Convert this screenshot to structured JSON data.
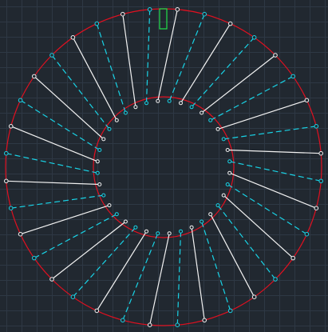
{
  "drawing": {
    "colors": {
      "background": "#212830",
      "grid": "#2e3844",
      "circles": "#e01020",
      "solid_lines": "#f2f2f2",
      "dashed_lines": "#19d3e6",
      "slot_marker": "#22e04a",
      "inner_node_white": "#f2f2f2",
      "inner_node_cyan": "#19d3e6"
    },
    "spoke_count": 36,
    "spoke_angle_step_deg": 10,
    "spoke_pattern": [
      "solid",
      "dashed"
    ]
  }
}
